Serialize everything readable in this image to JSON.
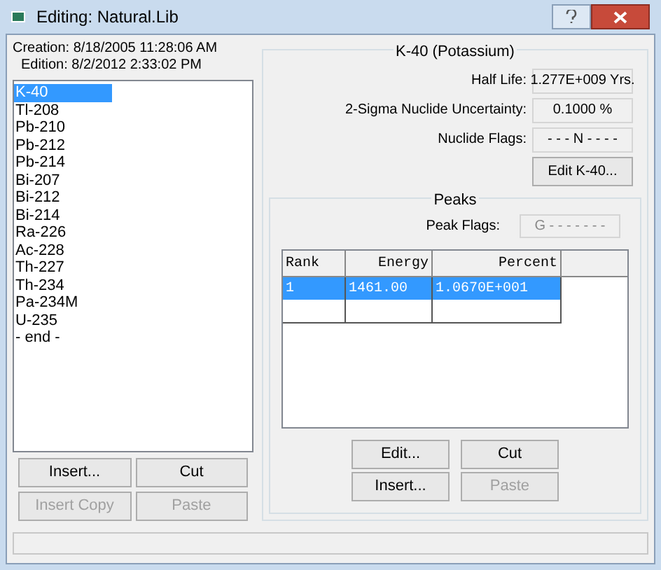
{
  "window": {
    "title": "Editing: Natural.Lib"
  },
  "creation": "Creation: 8/18/2005  11:28:06 AM",
  "edition": "Edition: 8/2/2012  2:33:02 PM",
  "nuclides": [
    {
      "label": "K-40",
      "selected": true
    },
    {
      "label": "Tl-208",
      "selected": false
    },
    {
      "label": "Pb-210",
      "selected": false
    },
    {
      "label": "Pb-212",
      "selected": false
    },
    {
      "label": "Pb-214",
      "selected": false
    },
    {
      "label": "Bi-207",
      "selected": false
    },
    {
      "label": "Bi-212",
      "selected": false
    },
    {
      "label": "Bi-214",
      "selected": false
    },
    {
      "label": "Ra-226",
      "selected": false
    },
    {
      "label": "Ac-228",
      "selected": false
    },
    {
      "label": "Th-227",
      "selected": false
    },
    {
      "label": "Th-234",
      "selected": false
    },
    {
      "label": "Pa-234M",
      "selected": false
    },
    {
      "label": "U-235",
      "selected": false
    },
    {
      "label": "- end -",
      "selected": false
    }
  ],
  "left_buttons": [
    {
      "label": "Insert...",
      "disabled": false
    },
    {
      "label": "Cut",
      "disabled": false
    },
    {
      "label": "Insert Copy",
      "disabled": true
    },
    {
      "label": "Paste",
      "disabled": true
    }
  ],
  "nuclide_group": {
    "title": "K-40 (Potassium)",
    "fields": [
      {
        "label": "Half Life:",
        "value": "1.277E+009 Yrs."
      },
      {
        "label": "2-Sigma Nuclide Uncertainty:",
        "value": "0.1000 %"
      },
      {
        "label": "Nuclide Flags:",
        "value": "- - - N - - - -"
      }
    ],
    "edit_button": "Edit K-40..."
  },
  "peaks": {
    "title": "Peaks",
    "flags_label": "Peak Flags:",
    "flags_value": "G - - - - - - -",
    "columns": [
      "Rank",
      "Energy",
      "Percent"
    ],
    "rows": [
      {
        "cells": [
          "1",
          "1461.00",
          "1.0670E+001"
        ],
        "selected": true
      }
    ],
    "buttons": [
      {
        "label": "Edit...",
        "disabled": false
      },
      {
        "label": "Cut",
        "disabled": false
      },
      {
        "label": "Insert...",
        "disabled": false
      },
      {
        "label": "Paste",
        "disabled": true
      }
    ]
  }
}
